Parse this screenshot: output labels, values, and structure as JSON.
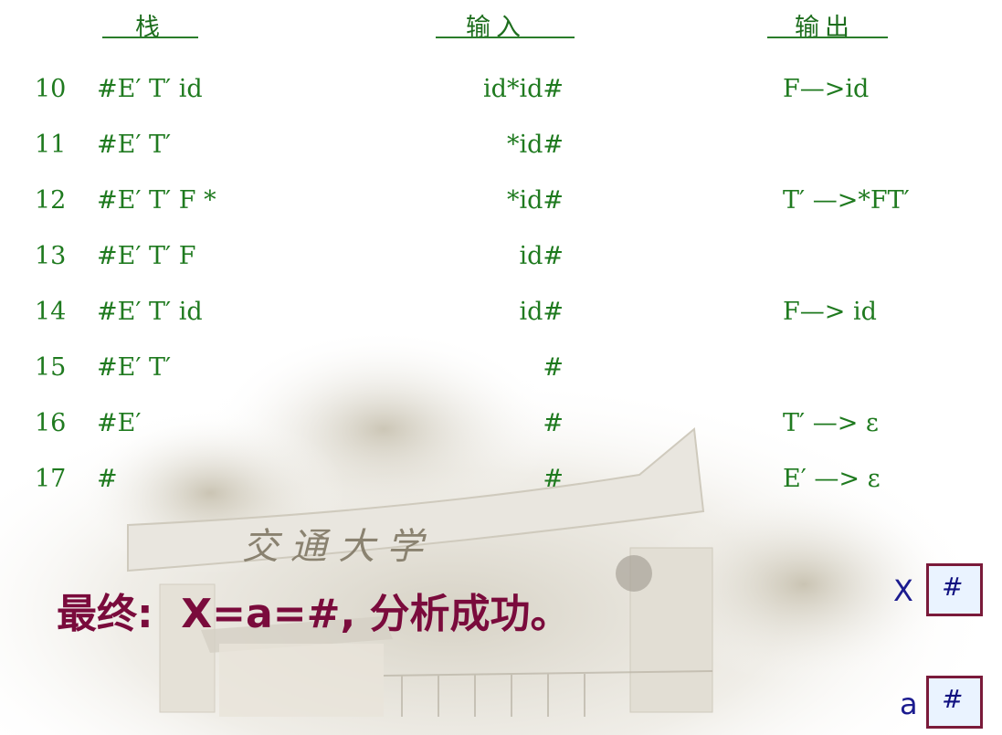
{
  "headers": {
    "stack": "栈",
    "input": "输入",
    "output": "输出"
  },
  "rows": [
    {
      "step": "10",
      "stack": "#E′ T′ id",
      "input": "id*id#",
      "output": "F—>id"
    },
    {
      "step": "11",
      "stack": "#E′ T′",
      "input": "*id#",
      "output": ""
    },
    {
      "step": "12",
      "stack": "#E′ T′ F *",
      "input": "*id#",
      "output": "T′ —>*FT′"
    },
    {
      "step": "13",
      "stack": "#E′ T′ F",
      "input": "id#",
      "output": ""
    },
    {
      "step": "14",
      "stack": "#E′ T′ id",
      "input": "id#",
      "output": "F—> id"
    },
    {
      "step": "15",
      "stack": "#E′ T′",
      "input": "#",
      "output": ""
    },
    {
      "step": "16",
      "stack": "#E′",
      "input": "#",
      "output": "T′ —> ε"
    },
    {
      "step": "17",
      "stack": "#",
      "input": "#",
      "output": "E′ —> ε"
    }
  ],
  "final_text": "最终:  X=a=#, 分析成功。",
  "registers": [
    {
      "label": "X",
      "value": "#"
    },
    {
      "label": "a",
      "value": "#"
    }
  ],
  "colors": {
    "table_text": "#1f7a1f",
    "final_text": "#7a0b3c",
    "register_label": "#1b1b8f",
    "register_border": "#7a1a3a"
  }
}
